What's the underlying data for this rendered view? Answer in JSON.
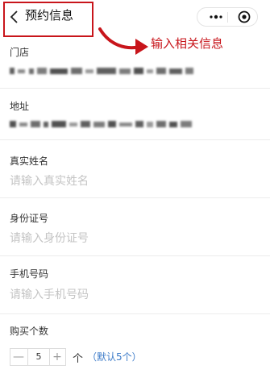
{
  "header": {
    "title": "预约信息",
    "back_icon": "chevron-left-icon",
    "more_icon": "more-dots-icon",
    "close_icon": "target-circle-icon"
  },
  "annotation": {
    "text": "输入相关信息",
    "color": "#c8151b"
  },
  "form": {
    "store": {
      "label": "门店",
      "value": ""
    },
    "address": {
      "label": "地址",
      "value": ""
    },
    "real_name": {
      "label": "真实姓名",
      "placeholder": "请输入真实姓名"
    },
    "id_number": {
      "label": "身份证号",
      "placeholder": "请输入身份证号"
    },
    "phone": {
      "label": "手机号码",
      "placeholder": "请输入手机号码"
    },
    "quantity": {
      "label": "购买个数",
      "value": "5",
      "minus": "—",
      "plus": "+",
      "unit": "个",
      "default_hint": "（默认5个）"
    }
  },
  "colors": {
    "link": "#3e7cc9",
    "placeholder": "#c4c4c4",
    "annotation": "#c8151b"
  }
}
